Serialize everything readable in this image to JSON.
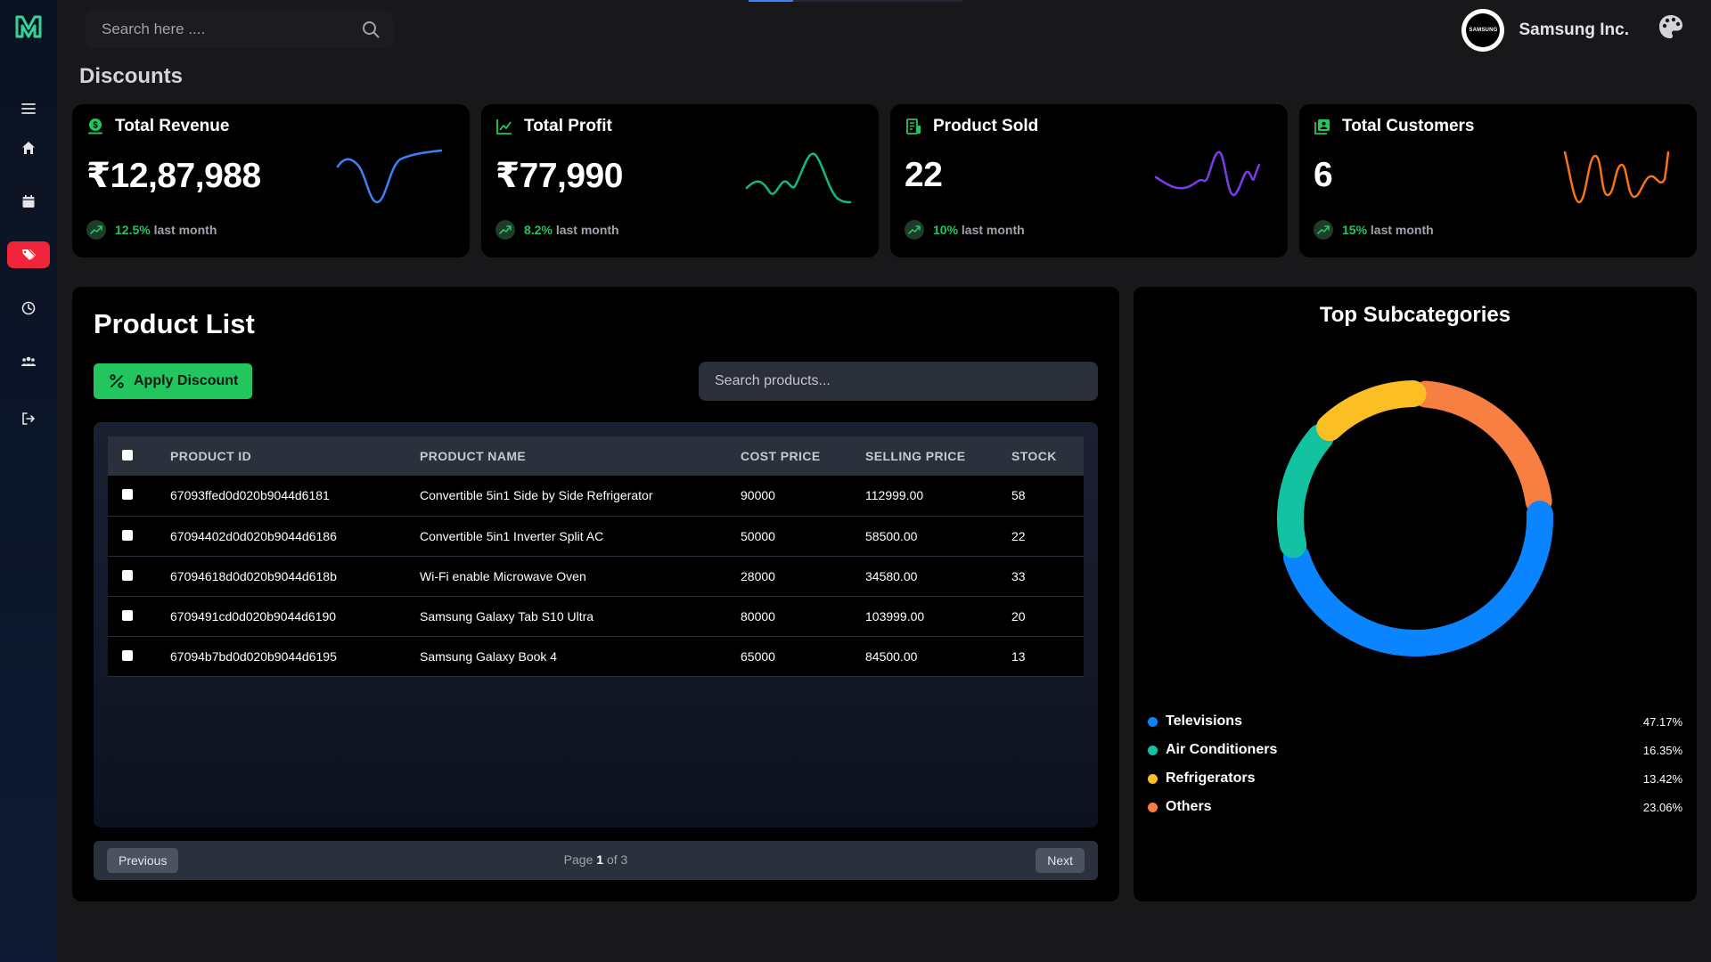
{
  "header": {
    "search_placeholder": "Search here ....",
    "company_name": "Samsung Inc.",
    "avatar_text": "SAMSUNG"
  },
  "sidebar": {
    "items": [
      {
        "icon": "menu-icon",
        "active": false
      },
      {
        "icon": "home-icon",
        "active": false
      },
      {
        "icon": "calendar-icon",
        "active": false
      },
      {
        "icon": "tags-icon",
        "active": true
      },
      {
        "icon": "clock-icon",
        "active": false
      },
      {
        "icon": "users-icon",
        "active": false
      },
      {
        "icon": "logout-icon",
        "active": false
      }
    ]
  },
  "page": {
    "title": "Discounts"
  },
  "stats": [
    {
      "label": "Total Revenue",
      "value": "₹12,87,988",
      "pct": "12.5%",
      "suffix": "last month",
      "icon": "money-icon",
      "color": "#3b82f6"
    },
    {
      "label": "Total Profit",
      "value": "₹77,990",
      "pct": "8.2%",
      "suffix": "last month",
      "icon": "trend-icon",
      "color": "#10b981"
    },
    {
      "label": "Product Sold",
      "value": "22",
      "pct": "10%",
      "suffix": "last month",
      "icon": "receipt-icon",
      "color": "#7c3aed"
    },
    {
      "label": "Total Customers",
      "value": "6",
      "pct": "15%",
      "suffix": "last month",
      "icon": "customers-icon",
      "color": "#f97316"
    }
  ],
  "products": {
    "title": "Product List",
    "apply_label": "Apply Discount",
    "search_placeholder": "Search products...",
    "columns": [
      "PRODUCT ID",
      "PRODUCT NAME",
      "COST PRICE",
      "SELLING PRICE",
      "STOCK"
    ],
    "rows": [
      {
        "id": "67093ffed0d020b9044d6181",
        "name": "Convertible 5in1 Side by Side Refrigerator",
        "cost": "90000",
        "sell": "112999.00",
        "stock": "58"
      },
      {
        "id": "67094402d0d020b9044d6186",
        "name": "Convertible 5in1 Inverter Split AC",
        "cost": "50000",
        "sell": "58500.00",
        "stock": "22"
      },
      {
        "id": "67094618d0d020b9044d618b",
        "name": "Wi-Fi enable Microwave Oven",
        "cost": "28000",
        "sell": "34580.00",
        "stock": "33"
      },
      {
        "id": "6709491cd0d020b9044d6190",
        "name": "Samsung Galaxy Tab S10 Ultra",
        "cost": "80000",
        "sell": "103999.00",
        "stock": "20"
      },
      {
        "id": "67094b7bd0d020b9044d6195",
        "name": "Samsung Galaxy Book 4",
        "cost": "65000",
        "sell": "84500.00",
        "stock": "13"
      }
    ],
    "pagination": {
      "prev_label": "Previous",
      "next_label": "Next",
      "page_word": "Page",
      "current": "1",
      "of_word": "of",
      "total": "3"
    }
  },
  "subcategories": {
    "title": "Top Subcategories",
    "items": [
      {
        "label": "Televisions",
        "pct_text": "47.17%",
        "value": 47.17,
        "color": "#0a84ff"
      },
      {
        "label": "Air Conditioners",
        "pct_text": "16.35%",
        "value": 16.35,
        "color": "#12c2a0"
      },
      {
        "label": "Refrigerators",
        "pct_text": "13.42%",
        "value": 13.42,
        "color": "#fbbf24"
      },
      {
        "label": "Others",
        "pct_text": "23.06%",
        "value": 23.06,
        "color": "#f77f42"
      }
    ]
  }
}
